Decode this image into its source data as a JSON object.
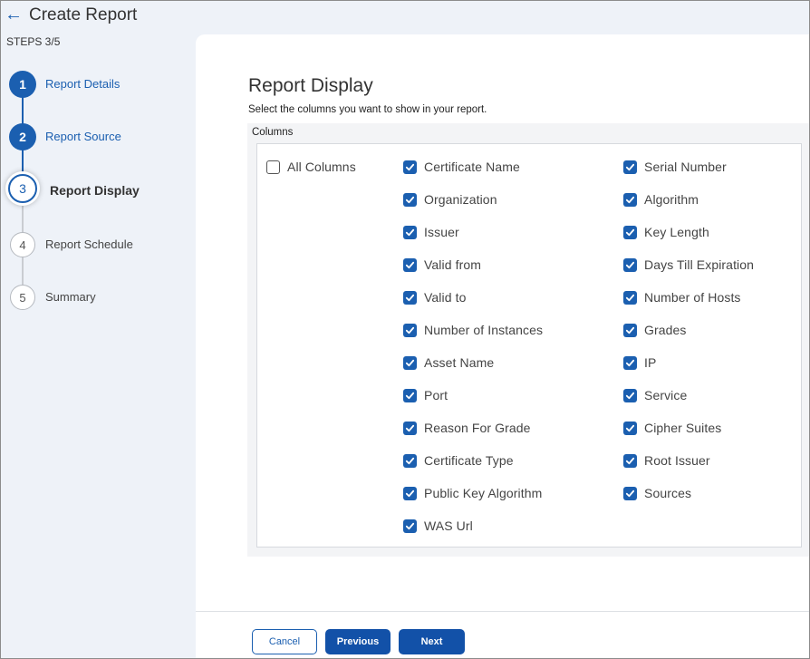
{
  "header": {
    "back_icon": "arrow-left-icon",
    "title": "Create Report",
    "steps_count": "STEPS 3/5"
  },
  "stepper": {
    "steps": [
      {
        "number": "1",
        "label": "Report Details",
        "state": "done"
      },
      {
        "number": "2",
        "label": "Report Source",
        "state": "done"
      },
      {
        "number": "3",
        "label": "Report Display",
        "state": "current"
      },
      {
        "number": "4",
        "label": "Report Schedule",
        "state": "todo"
      },
      {
        "number": "5",
        "label": "Summary",
        "state": "todo"
      }
    ]
  },
  "main": {
    "title": "Report Display",
    "subtitle": "Select the columns you want to show in your report.",
    "columns_label": "Columns",
    "all_columns": {
      "label": "All Columns",
      "checked": false
    },
    "column_options": [
      {
        "label": "Certificate Name",
        "checked": true
      },
      {
        "label": "Organization",
        "checked": true
      },
      {
        "label": "Issuer",
        "checked": true
      },
      {
        "label": "Valid from",
        "checked": true
      },
      {
        "label": "Valid to",
        "checked": true
      },
      {
        "label": "Number of Instances",
        "checked": true
      },
      {
        "label": "Asset Name",
        "checked": true
      },
      {
        "label": "Port",
        "checked": true
      },
      {
        "label": "Reason For Grade",
        "checked": true
      },
      {
        "label": "Certificate Type",
        "checked": true
      },
      {
        "label": "Public Key Algorithm",
        "checked": true
      },
      {
        "label": "WAS Url",
        "checked": true
      },
      {
        "label": "Serial Number",
        "checked": true
      },
      {
        "label": "Algorithm",
        "checked": true
      },
      {
        "label": "Key Length",
        "checked": true
      },
      {
        "label": "Days Till Expiration",
        "checked": true
      },
      {
        "label": "Number of Hosts",
        "checked": true
      },
      {
        "label": "Grades",
        "checked": true
      },
      {
        "label": "IP",
        "checked": true
      },
      {
        "label": "Service",
        "checked": true
      },
      {
        "label": "Cipher Suites",
        "checked": true
      },
      {
        "label": "Root Issuer",
        "checked": true
      },
      {
        "label": "Sources",
        "checked": true
      }
    ]
  },
  "footer": {
    "cancel_label": "Cancel",
    "previous_label": "Previous",
    "next_label": "Next"
  },
  "colors": {
    "accent": "#1b5fb0",
    "primary_button": "#1251a8",
    "sidebar_background": "#eef2f8"
  }
}
